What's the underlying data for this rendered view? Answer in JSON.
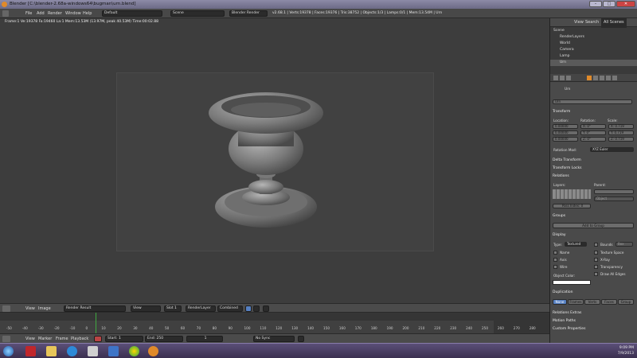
{
  "window": {
    "title": "Blender [C:\\blender-2.68a-windows64\\bugman\\urn.blend]",
    "buttons": [
      "–",
      "□",
      "✕"
    ]
  },
  "topbar": {
    "menus": [
      "File",
      "Add",
      "Render",
      "Window",
      "Help"
    ],
    "layout": "Default",
    "scene": "Scene",
    "engine": "Blender Render",
    "stats": "v2.68.1 | Verts:19378 | Faces:19376 | Tris:38752 | Objects:1/3 | Lamps:0/1 | Mem:13.54M | Urn"
  },
  "viewport": {
    "info": "Frame:1 Ve:19378 Fa:19460 La:1 Mem:13.53M (13.97M, peak 40.53M) Time:00:02.88"
  },
  "image_editor_header": {
    "items": [
      "View",
      "Image"
    ],
    "image": "Render Result",
    "view": "View",
    "slot": "Slot 1",
    "layer": "RenderLayer",
    "pass": "Combined"
  },
  "timeline": {
    "ticks": [
      "-50",
      "-40",
      "-30",
      "-20",
      "-10",
      "0",
      "10",
      "20",
      "30",
      "40",
      "50",
      "60",
      "70",
      "80",
      "90",
      "100",
      "110",
      "120",
      "130",
      "140",
      "150",
      "160",
      "170",
      "180",
      "190",
      "200",
      "210",
      "220",
      "230",
      "240",
      "250",
      "260",
      "270",
      "280"
    ],
    "menus": [
      "View",
      "Marker",
      "Frame",
      "Playback"
    ],
    "start": "Start: 1",
    "end": "End: 250",
    "current": "1",
    "sync": "No Sync"
  },
  "outliner": {
    "header": [
      "View",
      "Search",
      "All Scenes"
    ],
    "items": [
      "Scene",
      "RenderLayers",
      "World",
      "Camera",
      "Lamp",
      "Urn"
    ]
  },
  "properties": {
    "object_path": "Urn",
    "object_name": "Urn",
    "transform": {
      "title": "Transform",
      "location_label": "Location:",
      "rotation_label": "Rotation:",
      "scale_label": "Scale:",
      "location": [
        "0.00000",
        "0.00000",
        "0.00000"
      ],
      "rotation": [
        "X: 0°",
        "Y: 0°",
        "Z: 0°"
      ],
      "scale": [
        "X: 0.719",
        "Y: 0.719",
        "Z: 0.719"
      ],
      "rotation_mode_label": "Rotation Mod:",
      "rotation_mode": "XYZ Euler"
    },
    "collapsed_1": [
      "Delta Transform",
      "Transform Locks"
    ],
    "relations": {
      "title": "Relations",
      "layers": "Layers:",
      "parent": "Parent:",
      "object": "Object",
      "pass_index": "Pass Index: 0"
    },
    "groups": {
      "title": "Groups",
      "add": "Add to Group"
    },
    "display": {
      "title": "Display",
      "type_label": "Type:",
      "type": "Textured",
      "bounds": "Bounds",
      "box": "Box",
      "checks_left": [
        "Name",
        "Axis",
        "Wire"
      ],
      "checks_right": [
        "Texture Space",
        "X-Ray",
        "Transparency",
        "Draw All Edges"
      ],
      "object_color": "Object Color:"
    },
    "duplication": {
      "title": "Duplication",
      "options": [
        "None",
        "Frames",
        "Verts",
        "Faces",
        "Group"
      ]
    },
    "collapsed_2": [
      "Relations Extras",
      "Motion Paths",
      "Custom Properties"
    ]
  },
  "taskbar": {
    "time": "9:09 PM",
    "date": "7/9/2013"
  }
}
